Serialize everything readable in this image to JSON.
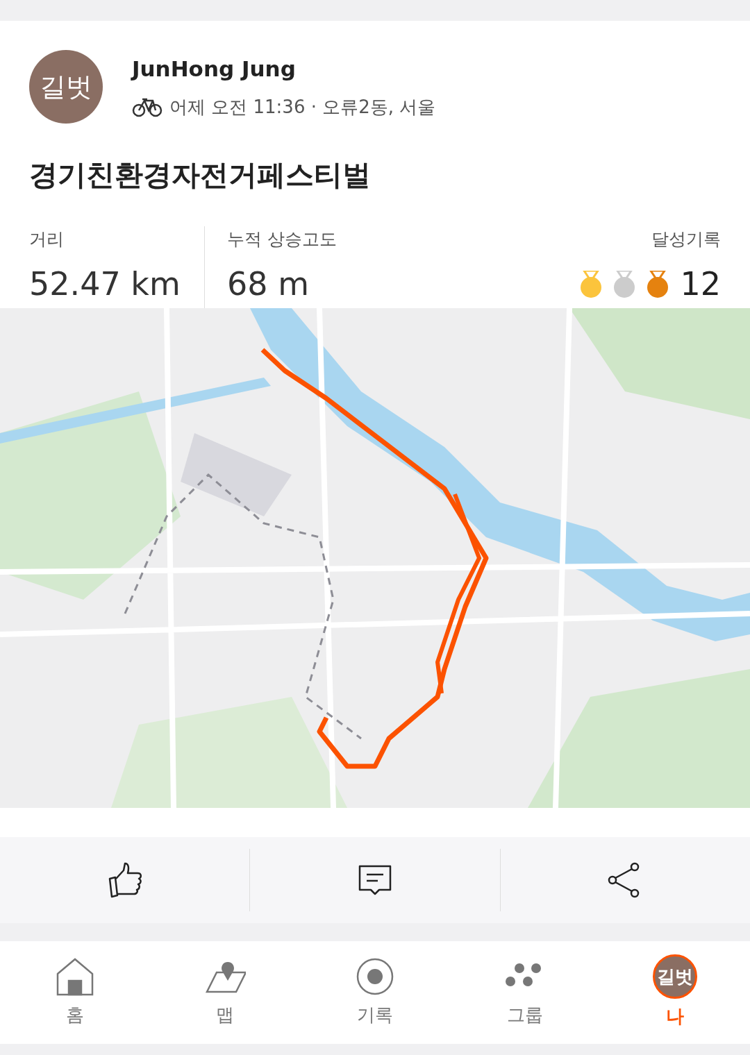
{
  "header": {
    "avatar": "길벗",
    "name": "JunHong Jung",
    "meta": "어제 오전 11:36 · 오류2동, 서울"
  },
  "title": "경기친환경자전거페스티벌",
  "stats": [
    {
      "label": "거리",
      "value": "52.47 km"
    },
    {
      "label": "누적 상승고도",
      "value": "68 m"
    }
  ],
  "achievements": {
    "label": "달성기록",
    "medals": [
      {
        "color": "#fbc43c"
      },
      {
        "color": "#cccccc"
      },
      {
        "color": "#e5820f"
      }
    ],
    "count": "12"
  },
  "actions": [
    {
      "kind": "like"
    },
    {
      "kind": "comment"
    },
    {
      "kind": "share"
    }
  ],
  "nav": [
    {
      "kind": "home",
      "label": "홈",
      "selected": false
    },
    {
      "kind": "map",
      "label": "맵",
      "selected": false
    },
    {
      "kind": "record",
      "label": "기록",
      "selected": false
    },
    {
      "kind": "group",
      "label": "그룹",
      "selected": false
    },
    {
      "kind": "avatar",
      "label": "나",
      "avatar": "길벗",
      "selected": true
    }
  ]
}
